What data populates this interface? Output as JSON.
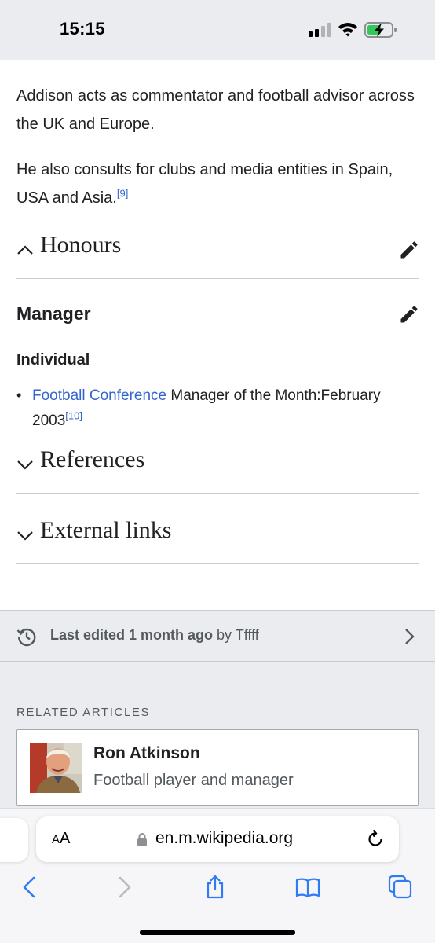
{
  "status_bar": {
    "time": "15:15"
  },
  "article": {
    "para1": "Addison acts as commentator and football advisor across the UK and Europe.",
    "para2_text": "He also consults for clubs and media entities in Spain, USA and Asia.",
    "para2_ref": "[9]",
    "sections": {
      "honours": "Honours",
      "references": "References",
      "external_links": "External links"
    },
    "honours": {
      "manager_heading": "Manager",
      "individual_heading": "Individual",
      "item_link": "Football Conference",
      "item_text_line1": " Manager of the Month:February",
      "item_text_line2": "2003",
      "item_ref": "[10]"
    }
  },
  "last_edited": {
    "bold": "Last edited 1 month ago",
    "by": " by Tffff"
  },
  "related": {
    "label": "RELATED ARTICLES",
    "items": [
      {
        "title": "Ron Atkinson",
        "description": "Football player and manager"
      }
    ]
  },
  "safari": {
    "aa_big": "A",
    "aa_small": "A",
    "url": "en.m.wikipedia.org"
  },
  "colors": {
    "link": "#3366cc",
    "chrome_gray": "#eaecf0",
    "safari_blue": "#2f7bf5"
  },
  "icons": [
    "signal-icon",
    "wifi-icon",
    "battery-charging-icon",
    "chevron-up-icon",
    "chevron-down-icon",
    "pencil-icon",
    "history-icon",
    "chevron-right-icon",
    "lock-icon",
    "reload-icon",
    "back-icon",
    "forward-icon",
    "share-icon",
    "bookmarks-icon",
    "tabs-icon"
  ]
}
